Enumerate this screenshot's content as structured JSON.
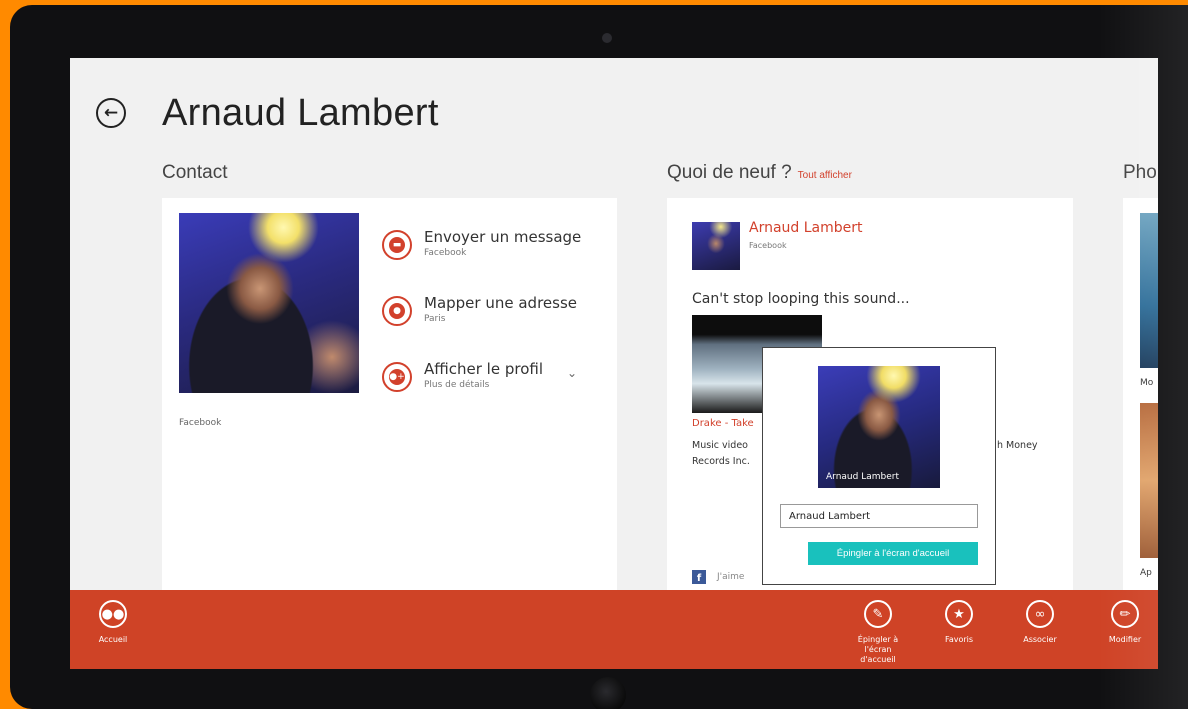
{
  "header": {
    "title": "Arnaud Lambert"
  },
  "contact": {
    "section_title": "Contact",
    "photo_source": "Facebook",
    "actions": [
      {
        "label": "Envoyer un message",
        "sub": "Facebook",
        "icon": "message-icon"
      },
      {
        "label": "Mapper une adresse",
        "sub": "Paris",
        "icon": "map-pin-icon"
      },
      {
        "label": "Afficher le profil",
        "sub": "Plus de détails",
        "icon": "profile-icon"
      }
    ]
  },
  "news": {
    "section_title": "Quoi de neuf ?",
    "see_all": "Tout afficher",
    "post": {
      "author": "Arnaud Lambert",
      "service": "Facebook",
      "text": "Can't stop looping this sound...",
      "video_title": "Drake - Take",
      "video_desc_left": "Music video",
      "video_desc_right": "h Money",
      "video_desc_line2": "Records Inc.",
      "like_text": "J'aime"
    }
  },
  "photos": {
    "section_title": "Pho",
    "item1_text": "Mo",
    "item2_text": "Ap"
  },
  "pin_flyout": {
    "tile_caption": "Arnaud Lambert",
    "tile_name_value": "Arnaud Lambert",
    "confirm_label": "Épingler à l'écran d'accueil"
  },
  "app_bar": {
    "home_label": "Accueil",
    "pin_label": "Épingler à l'écran d'accueil",
    "favorite_label": "Favoris",
    "link_label": "Associer",
    "edit_label": "Modifier"
  },
  "colors": {
    "accent": "#d2412c",
    "app_bar": "#cf4326",
    "pin_button": "#19c1bd",
    "frame": "#ff8a00"
  }
}
